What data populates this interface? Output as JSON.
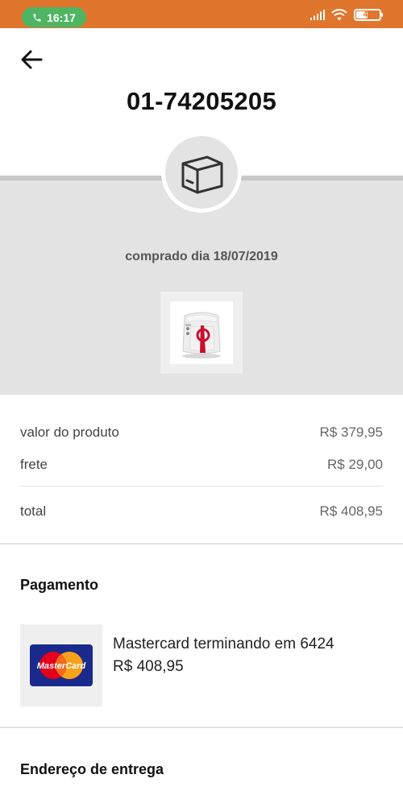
{
  "status_bar": {
    "time": "16:17",
    "battery": "41",
    "accent_color": "#e0762d",
    "call_color": "#4fb563"
  },
  "header": {
    "back_icon": "arrow-left-icon",
    "order_number": "01-74205205"
  },
  "order": {
    "status_icon": "package-box-icon",
    "purchase_date": "comprado dia 18/07/2019"
  },
  "prices": {
    "product_label": "valor do produto",
    "product_value": "R$ 379,95",
    "shipping_label": "frete",
    "shipping_value": "R$ 29,00",
    "total_label": "total",
    "total_value": "R$ 408,95"
  },
  "payment": {
    "title": "Pagamento",
    "card_brand": "MasterCard",
    "card_description": "Mastercard terminando em 6424",
    "amount": "R$ 408,95"
  },
  "delivery": {
    "title": "Endereço de entrega"
  }
}
